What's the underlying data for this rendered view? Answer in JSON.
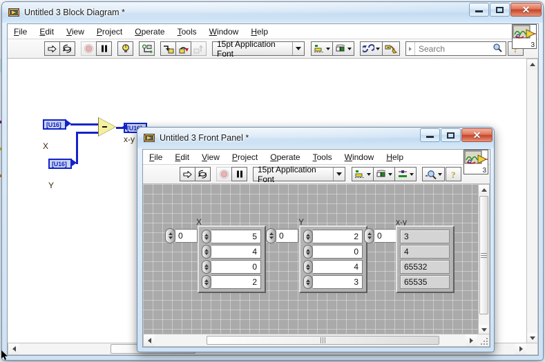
{
  "main_window": {
    "title": "Untitled 3 Block Diagram *",
    "icon": "labview-block-diagram-icon",
    "buttons": {
      "minimize": "minimize-icon",
      "maximize": "maximize-icon",
      "close": "close-icon",
      "close_glyph": "✕"
    },
    "menus": [
      {
        "label": "File",
        "mnemonic": "F"
      },
      {
        "label": "Edit",
        "mnemonic": "E"
      },
      {
        "label": "View",
        "mnemonic": "V"
      },
      {
        "label": "Project",
        "mnemonic": "P"
      },
      {
        "label": "Operate",
        "mnemonic": "O"
      },
      {
        "label": "Tools",
        "mnemonic": "T"
      },
      {
        "label": "Window",
        "mnemonic": "W"
      },
      {
        "label": "Help",
        "mnemonic": "H"
      }
    ],
    "toolbar": {
      "run": "run-arrow-icon",
      "run_continuously": "run-continuously-icon",
      "abort": "abort-execution-icon",
      "pause": "pause-icon",
      "highlight_execution": "highlight-execution-bulb-icon",
      "retain_wire_values": "retain-wire-values-icon",
      "step_into": "step-into-icon",
      "step_over": "step-over-icon",
      "step_out": "step-out-icon",
      "font_selector": "15pt Application Font",
      "align_objects": "align-objects-icon",
      "distribute_objects": "distribute-objects-icon",
      "reorder": "reorder-icon",
      "clean_up_diagram": "clean-up-diagram-icon",
      "search_placeholder": "Search",
      "search_value": "",
      "search_icon": "magnifier-icon",
      "help_icon": "context-help-icon"
    },
    "vi_icon": {
      "name": "vi-icon-badge",
      "number": "3"
    }
  },
  "block_diagram": {
    "nodes": [
      {
        "label": "X",
        "type": "U16",
        "kind": "control"
      },
      {
        "label": "Y",
        "type": "U16",
        "kind": "control"
      },
      {
        "label": "x-y",
        "type": "U16",
        "kind": "indicator"
      }
    ],
    "function_node": {
      "name": "subtract-function",
      "symbol": "−"
    }
  },
  "front_panel_window": {
    "title": "Untitled 3 Front Panel *",
    "icon": "labview-front-panel-icon",
    "buttons": {
      "minimize": "minimize-icon",
      "maximize": "maximize-icon",
      "close": "close-icon",
      "close_glyph": "✕"
    },
    "menus": [
      {
        "label": "File",
        "mnemonic": "F"
      },
      {
        "label": "Edit",
        "mnemonic": "E"
      },
      {
        "label": "View",
        "mnemonic": "V"
      },
      {
        "label": "Project",
        "mnemonic": "P"
      },
      {
        "label": "Operate",
        "mnemonic": "O"
      },
      {
        "label": "Tools",
        "mnemonic": "T"
      },
      {
        "label": "Window",
        "mnemonic": "W"
      },
      {
        "label": "Help",
        "mnemonic": "H"
      }
    ],
    "toolbar": {
      "run": "run-arrow-icon",
      "run_continuously": "run-continuously-icon",
      "abort": "abort-execution-icon",
      "pause": "pause-icon",
      "font_selector": "15pt Application Font",
      "align_objects": "align-objects-icon",
      "distribute_objects": "distribute-objects-icon",
      "resize_objects": "resize-objects-icon",
      "reorder": "reorder-zoom-icon",
      "help_icon": "context-help-icon"
    },
    "vi_icon": {
      "name": "vi-icon-badge",
      "number": "3"
    },
    "controls": [
      {
        "label": "X",
        "kind": "array-control",
        "index": "0",
        "values": [
          "5",
          "4",
          "0",
          "2"
        ]
      },
      {
        "label": "Y",
        "kind": "array-control",
        "index": "0",
        "values": [
          "2",
          "0",
          "4",
          "3"
        ]
      },
      {
        "label": "x-y",
        "kind": "array-indicator",
        "index": "0",
        "values": [
          "3",
          "4",
          "65532",
          "65535"
        ]
      }
    ]
  },
  "colors": {
    "wire": "#1323c8",
    "terminal_border": "#1323c8",
    "terminal_fill": "#c9d4f0",
    "function_fill": "#f5f0a0",
    "panel_grid": "#aaaaaa",
    "close_button": "#c3472c",
    "title_gradient_top": "#dceaf7"
  }
}
